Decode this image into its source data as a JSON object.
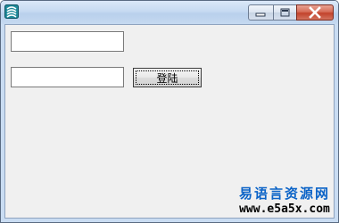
{
  "window": {
    "title": "",
    "icon": "app-icon",
    "caption_buttons": [
      "minimize-icon",
      "maximize-icon",
      "close-icon"
    ]
  },
  "form": {
    "username": {
      "value": "",
      "placeholder": ""
    },
    "password": {
      "value": "",
      "placeholder": ""
    },
    "login_label": "登陆"
  },
  "watermark": {
    "site_name": "易语言资源网",
    "url": "www.e5a5x.com"
  },
  "colors": {
    "title_bar": "#c6daf1",
    "client_bg": "#f0f0f0",
    "close_button": "#c2432c",
    "watermark_blue": "#0b63c7"
  }
}
